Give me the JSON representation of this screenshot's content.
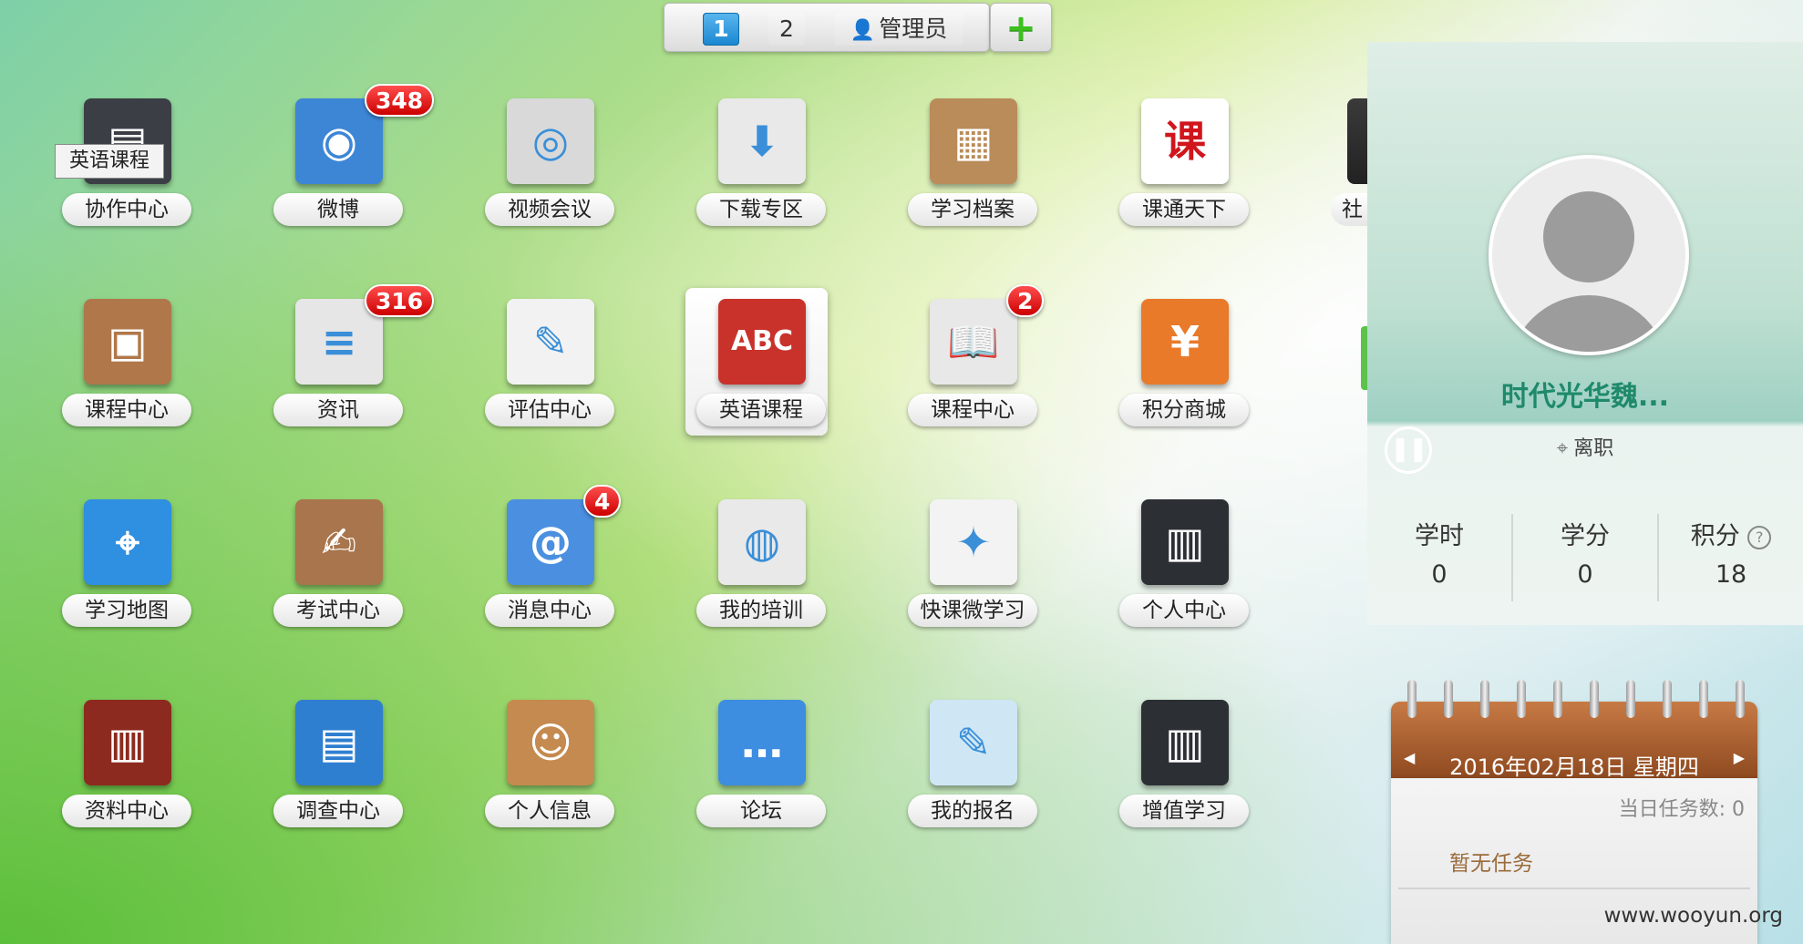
{
  "switcher": {
    "page1": "1",
    "page2": "2",
    "admin_label": "管理员",
    "add_label": "+"
  },
  "apps": [
    {
      "label": "协作中心",
      "icon": "collab-icon",
      "glyph": "▤",
      "bg": "#3b3f45"
    },
    {
      "label": "微博",
      "icon": "weibo-icon",
      "glyph": "◉",
      "bg": "#3d86d6",
      "badge": "348"
    },
    {
      "label": "视频会议",
      "icon": "webcam-icon",
      "glyph": "◎",
      "bg": "#d9d9d9"
    },
    {
      "label": "下载专区",
      "icon": "download-icon",
      "glyph": "⬇",
      "bg": "#e9e9e9"
    },
    {
      "label": "学习档案",
      "icon": "files-icon",
      "glyph": "▦",
      "bg": "#b98c5a"
    },
    {
      "label": "课通天下",
      "icon": "ke-icon",
      "glyph": "课",
      "bg": "#ffffff"
    },
    {
      "label": "课程中心",
      "icon": "media-icon",
      "glyph": "▣",
      "bg": "#b0784a"
    },
    {
      "label": "资讯",
      "icon": "news-icon",
      "glyph": "≡",
      "bg": "#e6e6e6",
      "badge": "316"
    },
    {
      "label": "评估中心",
      "icon": "edit-icon",
      "glyph": "✎",
      "bg": "#f2f2f2"
    },
    {
      "label": "英语课程",
      "icon": "abc-icon",
      "glyph": "ABC",
      "bg": "#c8322a"
    },
    {
      "label": "课程中心",
      "icon": "book-icon",
      "glyph": "📖",
      "bg": "#e8e8e8",
      "badge": "2"
    },
    {
      "label": "积分商城",
      "icon": "yen-icon",
      "glyph": "¥",
      "bg": "#e87a2a"
    },
    {
      "label": "学习地图",
      "icon": "map-icon",
      "glyph": "⌖",
      "bg": "#2f8fe0"
    },
    {
      "label": "考试中心",
      "icon": "exam-icon",
      "glyph": "✍",
      "bg": "#a9754c"
    },
    {
      "label": "消息中心",
      "icon": "mail-icon",
      "glyph": "@",
      "bg": "#4b8fe0",
      "badge": "4"
    },
    {
      "label": "我的培训",
      "icon": "training-icon",
      "glyph": "◍",
      "bg": "#e9e9e9"
    },
    {
      "label": "快课微学习",
      "icon": "runner-icon",
      "glyph": "✦",
      "bg": "#f3f3f3"
    },
    {
      "label": "个人中心",
      "icon": "folder-icon",
      "glyph": "▥",
      "bg": "#2c2f34"
    },
    {
      "label": "资料中心",
      "icon": "library-icon",
      "glyph": "▥",
      "bg": "#8c2a1f"
    },
    {
      "label": "调查中心",
      "icon": "clipboard-icon",
      "glyph": "▤",
      "bg": "#2f7fd0"
    },
    {
      "label": "个人信息",
      "icon": "contacts-icon",
      "glyph": "☺",
      "bg": "#c58a4f"
    },
    {
      "label": "论坛",
      "icon": "chat-icon",
      "glyph": "…",
      "bg": "#3d8de0"
    },
    {
      "label": "我的报名",
      "icon": "signup-icon",
      "glyph": "✎",
      "bg": "#cfe7f5"
    },
    {
      "label": "增值学习",
      "icon": "folder-icon",
      "glyph": "▥",
      "bg": "#2c2f34"
    }
  ],
  "tooltip": "英语课程",
  "partial_label": "社",
  "profile": {
    "name": "时代光华魏...",
    "status": "离职",
    "stats": [
      {
        "label": "学时",
        "value": "0"
      },
      {
        "label": "学分",
        "value": "0"
      },
      {
        "label": "积分",
        "value": "18",
        "help": "?"
      }
    ]
  },
  "calendar": {
    "date": "2016年02月18日 星期四",
    "task_count_label": "当日任务数: 0",
    "no_task": "暂无任务"
  },
  "watermark": "www.wooyun.org"
}
